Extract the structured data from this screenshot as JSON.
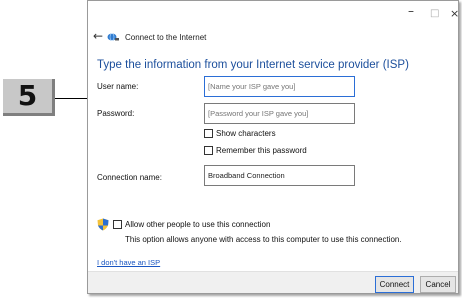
{
  "callout": {
    "number": "5"
  },
  "window": {
    "controls": {
      "minimize": "–",
      "maximize": "□",
      "close": "×"
    },
    "nav": {
      "back": "←",
      "title": "Connect to the Internet"
    },
    "heading": "Type the information from your Internet service provider (ISP)",
    "form": {
      "username_label": "User name:",
      "username_placeholder": "[Name your ISP gave you]",
      "password_label": "Password:",
      "password_placeholder": "[Password your ISP gave you]",
      "show_characters": "Show characters",
      "remember_password": "Remember this password",
      "connection_name_label": "Connection name:",
      "connection_name_value": "Broadband Connection"
    },
    "sharing": {
      "allow_label": "Allow other people to use this connection",
      "allow_description": "This option allows anyone with access to this computer to use this connection."
    },
    "link": "I don't have an ISP",
    "buttons": {
      "connect": "Connect",
      "cancel": "Cancel"
    }
  }
}
